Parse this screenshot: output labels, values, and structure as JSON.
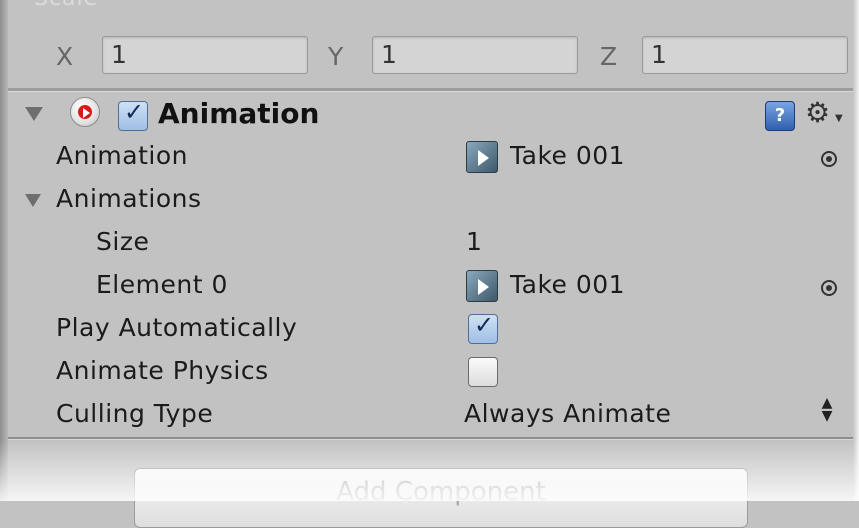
{
  "transform": {
    "section_label": "Scale",
    "x_label": "X",
    "x_value": "1",
    "y_label": "Y",
    "y_value": "1",
    "z_label": "Z",
    "z_value": "1"
  },
  "component": {
    "title": "Animation",
    "enabled": true,
    "icons": [
      "fold-arrow-icon",
      "animation-component-icon",
      "help-icon",
      "gear-icon"
    ]
  },
  "properties": {
    "animation_label": "Animation",
    "animation_clip": "Take 001",
    "animations_label": "Animations",
    "size_label": "Size",
    "size_value": "1",
    "element0_label": "Element 0",
    "element0_clip": "Take 001",
    "play_auto_label": "Play Automatically",
    "play_auto_checked": true,
    "animate_physics_label": "Animate Physics",
    "animate_physics_checked": false,
    "culling_label": "Culling Type",
    "culling_value": "Always Animate"
  },
  "footer": {
    "add_component_label": "Add Component"
  },
  "colors": {
    "panel_bg": "#c2c2c2",
    "checkbox_checked": "#9fbfe6",
    "record_red": "#d61a1a"
  }
}
